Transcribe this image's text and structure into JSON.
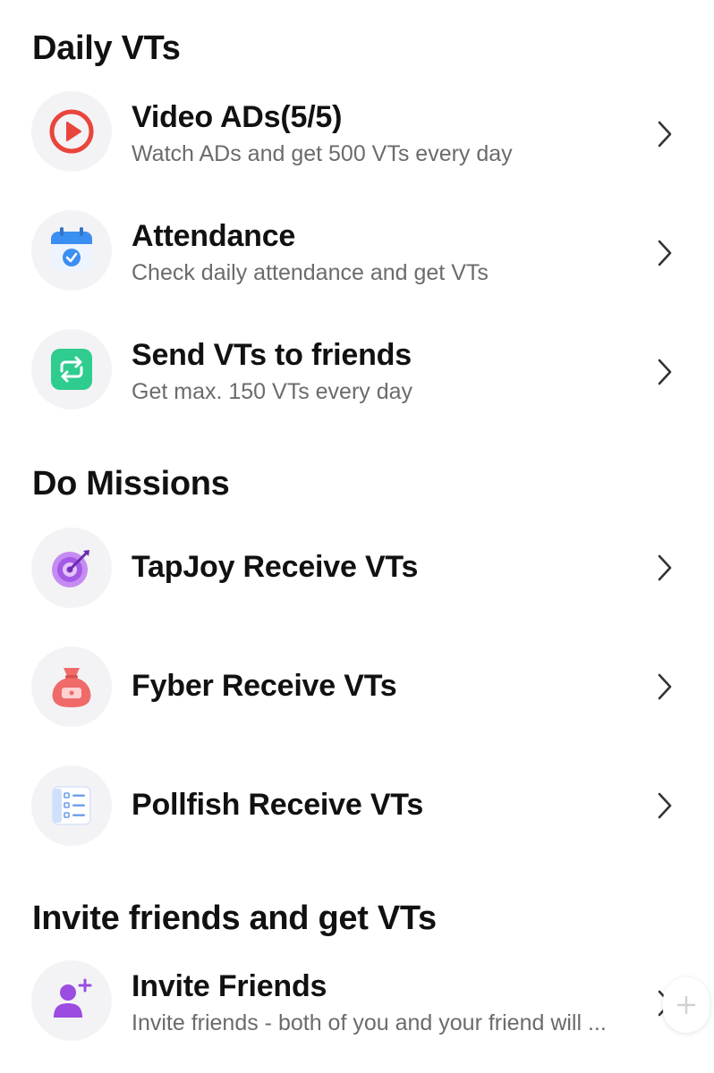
{
  "sections": [
    {
      "title": "Daily VTs",
      "items": [
        {
          "icon": "play-icon",
          "title": "Video ADs(5/5)",
          "subtitle": "Watch ADs and get 500 VTs every day"
        },
        {
          "icon": "calendar-check-icon",
          "title": "Attendance",
          "subtitle": "Check daily attendance and get VTs"
        },
        {
          "icon": "exchange-icon",
          "title": "Send VTs to friends",
          "subtitle": "Get max. 150 VTs every day"
        }
      ]
    },
    {
      "title": "Do Missions",
      "items": [
        {
          "icon": "target-icon",
          "title": "TapJoy Receive VTs"
        },
        {
          "icon": "money-bag-icon",
          "title": "Fyber Receive VTs"
        },
        {
          "icon": "survey-list-icon",
          "title": "Pollfish Receive VTs"
        }
      ]
    },
    {
      "title": "Invite friends and get VTs",
      "items": [
        {
          "icon": "add-user-icon",
          "title": "Invite Friends",
          "subtitle": "Invite friends - both of you and your friend will ..."
        }
      ]
    }
  ],
  "colors": {
    "play": "#e8453c",
    "calendar": "#3b8ff0",
    "exchange": "#2ecc8f",
    "target": "#a45ae6",
    "money_bag": "#f06a6a",
    "survey": "#8fb6f5",
    "add_user": "#9a4de0"
  },
  "fab_icon": "plus-icon"
}
